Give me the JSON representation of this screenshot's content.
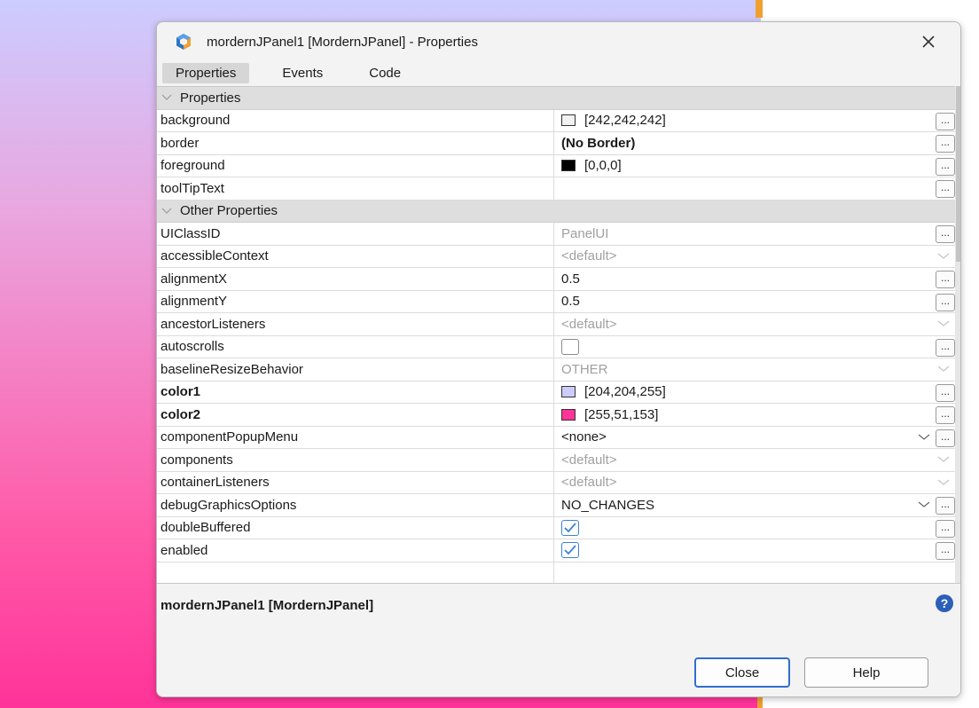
{
  "window": {
    "title": "mordernJPanel1 [MordernJPanel] - Properties",
    "close_icon": "close-icon"
  },
  "tabs": [
    {
      "label": "Properties",
      "active": true
    },
    {
      "label": "Events",
      "active": false
    },
    {
      "label": "Code",
      "active": false
    }
  ],
  "sections": {
    "properties": "Properties",
    "other": "Other Properties"
  },
  "rows": {
    "background": {
      "name": "background",
      "value": "[242,242,242]",
      "swatch": "#f2f2f2"
    },
    "border": {
      "name": "border",
      "value": "(No Border)"
    },
    "foreground": {
      "name": "foreground",
      "value": "[0,0,0]",
      "swatch": "#000000"
    },
    "toolTipText": {
      "name": "toolTipText",
      "value": ""
    },
    "UIClassID": {
      "name": "UIClassID",
      "value": "PanelUI"
    },
    "accessibleContext": {
      "name": "accessibleContext",
      "value": "<default>"
    },
    "alignmentX": {
      "name": "alignmentX",
      "value": "0.5"
    },
    "alignmentY": {
      "name": "alignmentY",
      "value": "0.5"
    },
    "ancestorListeners": {
      "name": "ancestorListeners",
      "value": "<default>"
    },
    "autoscrolls": {
      "name": "autoscrolls",
      "checked": false
    },
    "baselineResizeBehavior": {
      "name": "baselineResizeBehavior",
      "value": "OTHER"
    },
    "color1": {
      "name": "color1",
      "value": "[204,204,255]",
      "swatch": "#ccccff"
    },
    "color2": {
      "name": "color2",
      "value": "[255,51,153]",
      "swatch": "#ff3399"
    },
    "componentPopupMenu": {
      "name": "componentPopupMenu",
      "value": "<none>"
    },
    "components": {
      "name": "components",
      "value": "<default>"
    },
    "containerListeners": {
      "name": "containerListeners",
      "value": "<default>"
    },
    "debugGraphicsOptions": {
      "name": "debugGraphicsOptions",
      "value": "NO_CHANGES"
    },
    "doubleBuffered": {
      "name": "doubleBuffered",
      "checked": true
    },
    "enabled": {
      "name": "enabled",
      "checked": true
    }
  },
  "dots_label": "...",
  "description": {
    "title": "mordernJPanel1 [MordernJPanel]",
    "help_icon": "?"
  },
  "buttons": {
    "close": "Close",
    "help": "Help"
  },
  "colors": {
    "accent": "#2f6fcd",
    "checkbox": "#3b82d6",
    "gradient_top": "#ccccff",
    "gradient_bottom": "#ff3399"
  }
}
